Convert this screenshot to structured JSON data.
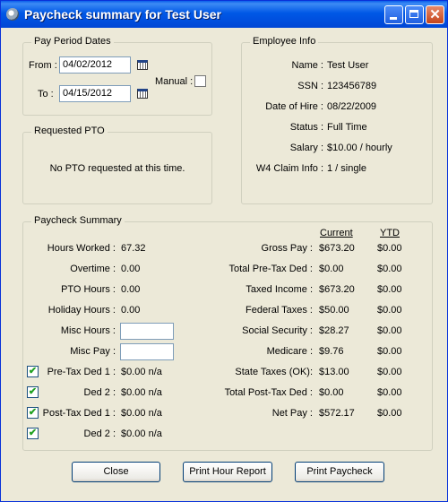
{
  "window": {
    "title": "Paycheck summary for Test User"
  },
  "pay_period": {
    "legend": "Pay Period Dates",
    "from_label": "From :",
    "from_value": "04/02/2012",
    "to_label": "To :",
    "to_value": "04/15/2012",
    "manual_label": "Manual :"
  },
  "employee": {
    "legend": "Employee Info",
    "rows": [
      {
        "label": "Name :",
        "value": "Test User"
      },
      {
        "label": "SSN :",
        "value": "123456789"
      },
      {
        "label": "Date of Hire :",
        "value": "08/22/2009"
      },
      {
        "label": "Status :",
        "value": "Full Time"
      },
      {
        "label": "Salary :",
        "value": "$10.00 / hourly"
      },
      {
        "label": "W4 Claim Info :",
        "value": "1 / single"
      }
    ]
  },
  "pto": {
    "legend": "Requested PTO",
    "message": "No PTO requested at this time."
  },
  "summary": {
    "legend": "Paycheck Summary",
    "current_header": "Current",
    "ytd_header": "YTD",
    "left": [
      {
        "label": "Hours Worked :",
        "value": "67.32"
      },
      {
        "label": "Overtime :",
        "value": "0.00"
      },
      {
        "label": "PTO Hours :",
        "value": "0.00"
      },
      {
        "label": "Holiday Hours :",
        "value": "0.00"
      },
      {
        "label": "Misc Hours :",
        "value": ""
      },
      {
        "label": "Misc Pay :",
        "value": ""
      },
      {
        "label": "Pre-Tax Ded 1 :",
        "value": "$0.00 n/a",
        "checked": true
      },
      {
        "label": "Ded 2 :",
        "value": "$0.00 n/a",
        "checked": true
      },
      {
        "label": "Post-Tax Ded 1 :",
        "value": "$0.00 n/a",
        "checked": true
      },
      {
        "label": "Ded 2 :",
        "value": "$0.00 n/a",
        "checked": true
      }
    ],
    "right": [
      {
        "label": "Gross Pay :",
        "current": "$673.20",
        "ytd": "$0.00"
      },
      {
        "label": "Total Pre-Tax Ded :",
        "current": "$0.00",
        "ytd": "$0.00"
      },
      {
        "label": "Taxed Income :",
        "current": "$673.20",
        "ytd": "$0.00"
      },
      {
        "label": "Federal Taxes :",
        "current": "$50.00",
        "ytd": "$0.00"
      },
      {
        "label": "Social Security :",
        "current": "$28.27",
        "ytd": "$0.00"
      },
      {
        "label": "Medicare :",
        "current": "$9.76",
        "ytd": "$0.00"
      },
      {
        "label": "State Taxes (OK):",
        "current": "$13.00",
        "ytd": "$0.00"
      },
      {
        "label": "Total Post-Tax Ded :",
        "current": "$0.00",
        "ytd": "$0.00"
      },
      {
        "label": "Net Pay :",
        "current": "$572.17",
        "ytd": "$0.00"
      }
    ]
  },
  "buttons": {
    "close": "Close",
    "print_hours": "Print Hour Report",
    "print_paycheck": "Print Paycheck"
  }
}
